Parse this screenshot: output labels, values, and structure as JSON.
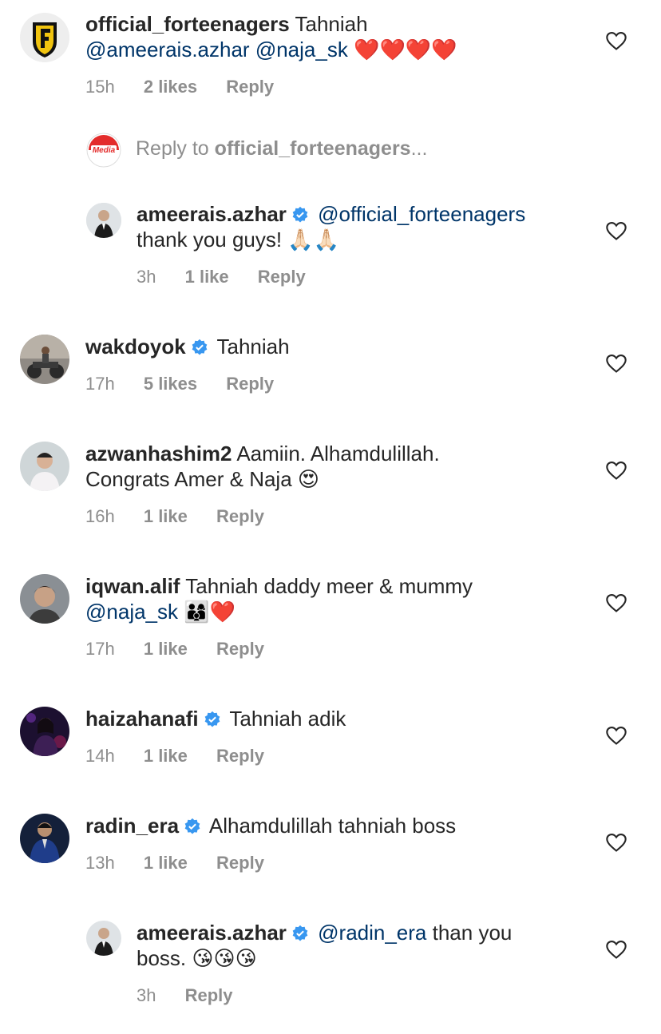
{
  "icons": {
    "like": "heart-outline-icon",
    "verified": "verified-badge-icon"
  },
  "colors": {
    "mention": "#003569",
    "verified": "#3897f0",
    "meta": "#8e8e8e",
    "heart_emoji": "#e0245e"
  },
  "comments": [
    {
      "user": "official_forteenagers",
      "text": "Tahniah",
      "mentions": [
        "@ameerais.azhar",
        "@naja_sk"
      ],
      "emoji": "❤️❤️❤️❤️",
      "time": "15h",
      "likes": "2 likes",
      "reply": "Reply"
    },
    {
      "reply_prompt": {
        "prefix": "Reply to ",
        "user": "official_forteenagers",
        "suffix": "..."
      }
    },
    {
      "user": "ameerais.azhar",
      "mention": "@official_forteenagers",
      "text": "thank you guys!",
      "emoji": "🙏🏻🙏🏻",
      "time": "3h",
      "likes": "1 like",
      "reply": "Reply"
    },
    {
      "user": "wakdoyok",
      "text": "Tahniah",
      "time": "17h",
      "likes": "5 likes",
      "reply": "Reply"
    },
    {
      "user": "azwanhashim2",
      "text": "Aamiin. Alhamdulillah.",
      "text2": "Congrats Amer & Naja",
      "emoji": "😍",
      "time": "16h",
      "likes": "1 like",
      "reply": "Reply"
    },
    {
      "user": "iqwan.alif",
      "text": "Tahniah daddy meer & mummy",
      "mention": "@naja_sk",
      "emoji": "👨‍👩‍👦❤️",
      "time": "17h",
      "likes": "1 like",
      "reply": "Reply"
    },
    {
      "user": "haizahanafi",
      "text": "Tahniah adik",
      "time": "14h",
      "likes": "1 like",
      "reply": "Reply"
    },
    {
      "user": "radin_era",
      "text": "Alhamdulillah tahniah boss",
      "time": "13h",
      "likes": "1 like",
      "reply": "Reply"
    },
    {
      "user": "ameerais.azhar",
      "mention": "@radin_era",
      "text": "than you",
      "text2": "boss.",
      "emoji": "😘😘😘",
      "time": "3h",
      "reply": "Reply"
    }
  ]
}
